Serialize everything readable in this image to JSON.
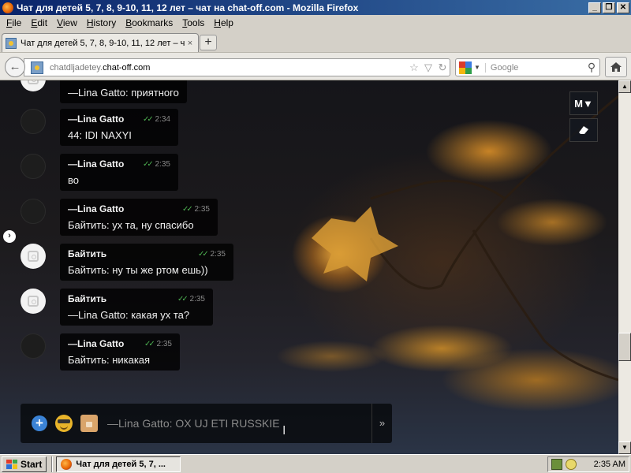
{
  "window": {
    "title": "Чат для детей 5, 7, 8, 9-10, 11, 12 лет – чат на chat-off.com - Mozilla Firefox",
    "minimize": "_",
    "maximize": "❐",
    "close": "✕"
  },
  "menu": [
    "File",
    "Edit",
    "View",
    "History",
    "Bookmarks",
    "Tools",
    "Help"
  ],
  "tab": {
    "label": "Чат для детей 5, 7, 8, 9-10, 11, 12 лет – чат...",
    "close": "×",
    "new": "+"
  },
  "nav": {
    "url_prefix": "chatdljadetey.",
    "url_domain": "chat-off.com",
    "search_placeholder": "Google"
  },
  "messages": [
    {
      "avatar": "light",
      "name": "",
      "time": "",
      "text": "—Lina Gatto: приятного"
    },
    {
      "avatar": "dark",
      "name": "—Lina Gatto",
      "time": "2:34",
      "text": "44: IDI NAXYI"
    },
    {
      "avatar": "dark",
      "name": "—Lina Gatto",
      "time": "2:35",
      "text": "во"
    },
    {
      "avatar": "dark",
      "name": "—Lina Gatto",
      "time": "2:35",
      "text": "Байтить: ух та, ну спасибо"
    },
    {
      "avatar": "light",
      "name": "Байтить",
      "time": "2:35",
      "text": "Байтить: ну ты же ртом ешь))"
    },
    {
      "avatar": "light",
      "name": "Байтить",
      "time": "2:35",
      "text": "—Lina Gatto: какая ух та?"
    },
    {
      "avatar": "dark",
      "name": "—Lina Gatto",
      "time": "2:35",
      "text": "Байтить: никакая"
    }
  ],
  "tools": {
    "mode_label": "M▼",
    "eraser_icon": "eraser-icon"
  },
  "composer": {
    "input_value": "—Lina Gatto: OX UJ ETI RUSSKIE",
    "send": "»"
  },
  "taskbar": {
    "start": "Start",
    "window_item": "Чат для детей 5, 7, ...",
    "clock": "2:35 AM"
  }
}
